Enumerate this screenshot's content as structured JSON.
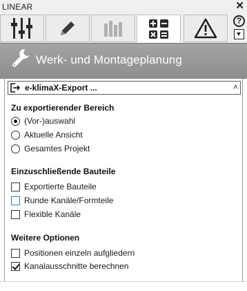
{
  "window": {
    "title": "LINEAR",
    "close_label": "✕"
  },
  "toolbar": {
    "tabs": [
      {
        "icon": "sliders-icon",
        "active": false
      },
      {
        "icon": "pencil-icon",
        "active": false
      },
      {
        "icon": "bar-chart-icon",
        "active": false
      },
      {
        "icon": "calculator-icon",
        "active": true
      },
      {
        "icon": "warning-icon",
        "active": false
      }
    ],
    "help_label": "?",
    "dropdown_icon": "dropdown-arrow-icon"
  },
  "header": {
    "icon": "wrench-icon",
    "title": "Werk- und Montageplanung"
  },
  "panel": {
    "icon": "export-icon",
    "title": "e-klimaX-Export ...",
    "collapse_label": "˄",
    "sections": [
      {
        "heading": "Zu exportierender Bereich",
        "type": "radio",
        "options": [
          {
            "label": "(Vor-)auswahl",
            "checked": true
          },
          {
            "label": "Aktuelle Ansicht",
            "checked": false
          },
          {
            "label": "Gesamtes Projekt",
            "checked": false
          }
        ]
      },
      {
        "heading": "Einzuschließende Bauteile",
        "type": "checkbox",
        "options": [
          {
            "label": "Exportierte Bauteile",
            "checked": false
          },
          {
            "label": "Runde Kanäle/Formteile",
            "checked": false,
            "hovered": true
          },
          {
            "label": "Flexible Kanäle",
            "checked": false
          }
        ]
      },
      {
        "heading": "Weitere Optionen",
        "type": "checkbox",
        "options": [
          {
            "label": "Positionen einzeln aufgliedern",
            "checked": false
          },
          {
            "label": "Kanalausschnitte berechnen",
            "checked": true
          }
        ]
      }
    ]
  },
  "colors": {
    "header_band": "#999999",
    "hover_border": "#3c7fb1"
  }
}
